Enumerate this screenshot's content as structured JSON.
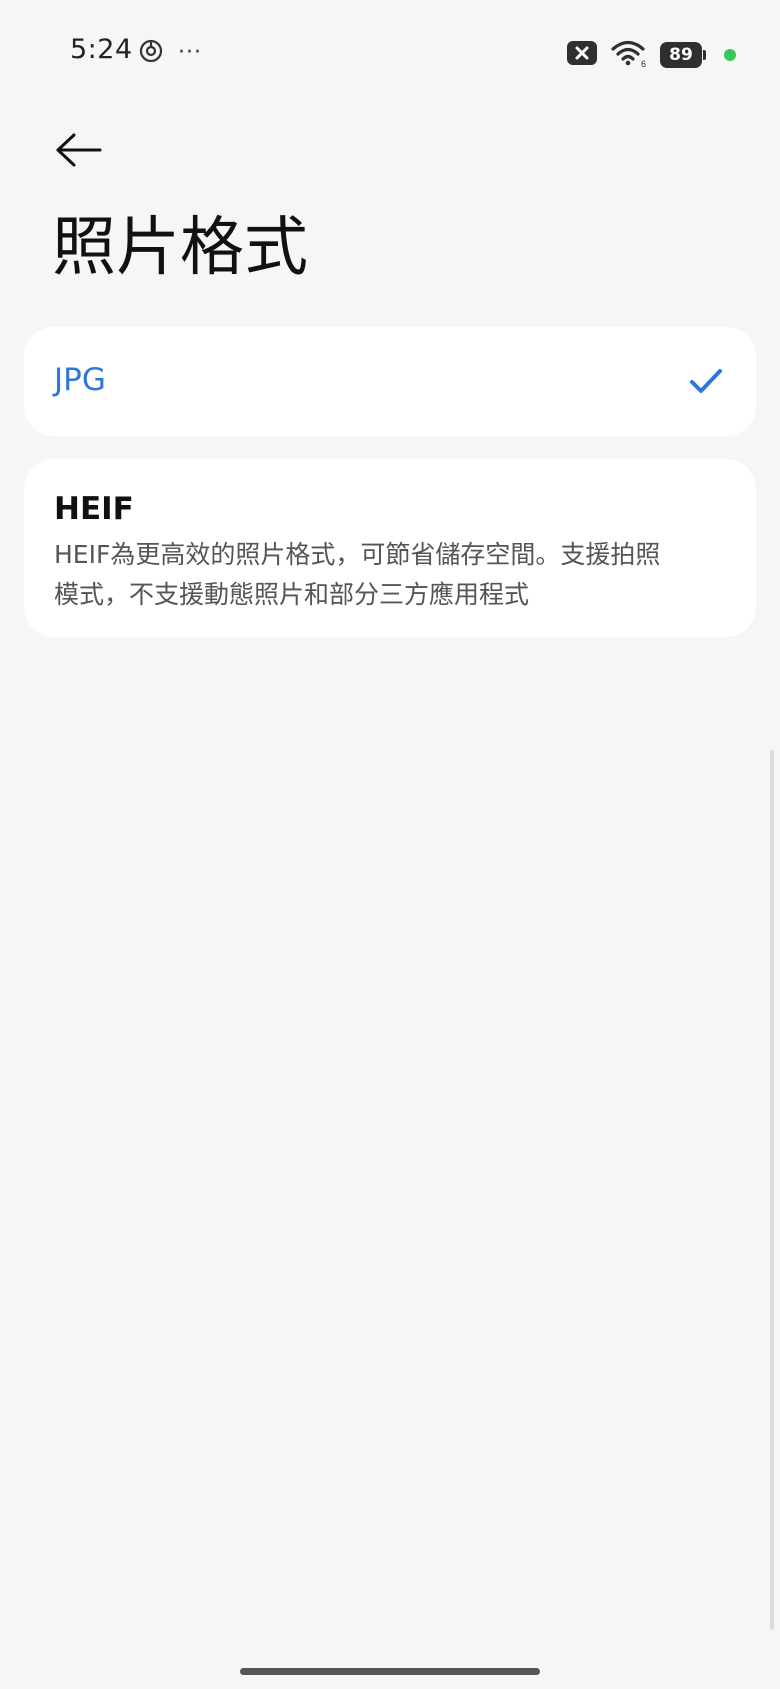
{
  "status_bar": {
    "time": "5:24",
    "dots": "···",
    "battery_level": "89",
    "icons": [
      "focus-icon",
      "more-dots-icon",
      "close-box-icon",
      "wifi-icon",
      "battery-icon",
      "green-dot-indicator"
    ]
  },
  "header": {
    "back_icon": "back-arrow-icon",
    "title": "照片格式"
  },
  "options": [
    {
      "label": "JPG",
      "selected": true,
      "icon": "checkmark-icon"
    },
    {
      "label": "HEIF",
      "description": "HEIF為更高效的照片格式，可節省儲存空間。支援拍照模式，不支援動態照片和部分三方應用程式",
      "selected": false
    }
  ],
  "colors": {
    "background": "#f6f6f6",
    "card": "#ffffff",
    "accent": "#2f78d6",
    "indicator_green": "#34c759"
  }
}
